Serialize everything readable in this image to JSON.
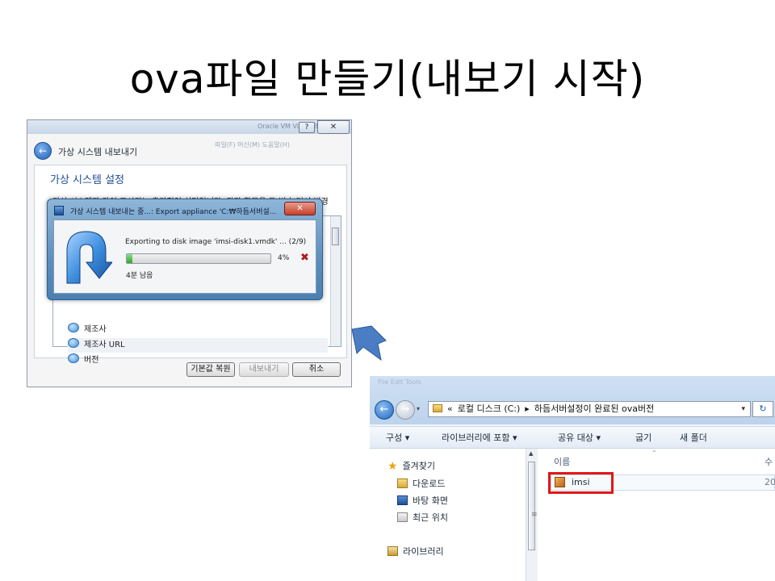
{
  "slide": {
    "title": "ova파일 만들기(내보기 시작)"
  },
  "wizard": {
    "bg_title": "Oracle VM VirtualBox",
    "bg_menu": "파일(F)   머신(M)   도움말(H)",
    "help_label": "?",
    "close_label": "✕",
    "back_glyph": "←",
    "header_title": "가상 시스템 내보내기",
    "settings_title": "가상 시스템 설정",
    "description": "가상 시스템과 같이 표시되는 추가적인 설명입니다. 각각 항목을 두 번 눌러서 변경",
    "properties": [
      {
        "label": "제조사"
      },
      {
        "label": "제조사 URL"
      },
      {
        "label": "버전"
      }
    ],
    "buttons": {
      "restore_defaults": "기본값 복원",
      "export": "내보내기",
      "cancel": "취소"
    }
  },
  "progress_dialog": {
    "title": "가상 시스템 내보내는 중...: Export appliance 'C:₩하듬서버설...",
    "close_label": "✕",
    "message": "Exporting to disk image 'imsi-disk1.vmdk' ... (2/9)",
    "progress_fraction": 0.04,
    "percent_text": "4%",
    "cancel_glyph": "✖",
    "eta": "4분 남음"
  },
  "explorer": {
    "hint_title": "File Edit Tools",
    "back_glyph": "←",
    "fwd_glyph": "→",
    "nav_drop": "▾",
    "address": {
      "prefix": "«",
      "crumbs": [
        "로컬 디스크 (C:)",
        "하듬서버설정이 완료된 ova버전"
      ],
      "separator": "▸",
      "dropdown": "▾"
    },
    "refresh_glyph": "↻",
    "commands": [
      {
        "label": "구성 ▾"
      },
      {
        "label": "라이브러리에 포함 ▾"
      },
      {
        "label": "공유 대상 ▾"
      },
      {
        "label": "굽기"
      },
      {
        "label": "새 폴더"
      }
    ],
    "nav_items": [
      {
        "label": "즐겨찾기",
        "icon": "star-icon"
      },
      {
        "label": "다운로드",
        "icon": "downloads-folder-icon"
      },
      {
        "label": "바탕 화면",
        "icon": "desktop-icon"
      },
      {
        "label": "최근 위치",
        "icon": "recent-places-icon"
      },
      {
        "label": "라이브러리",
        "icon": "library-icon"
      }
    ],
    "columns": {
      "name": "이름",
      "date": "수"
    },
    "files": [
      {
        "name": "imsi",
        "date": "20",
        "icon": "ova-package-icon"
      }
    ],
    "highlight_color": "#e01818"
  }
}
